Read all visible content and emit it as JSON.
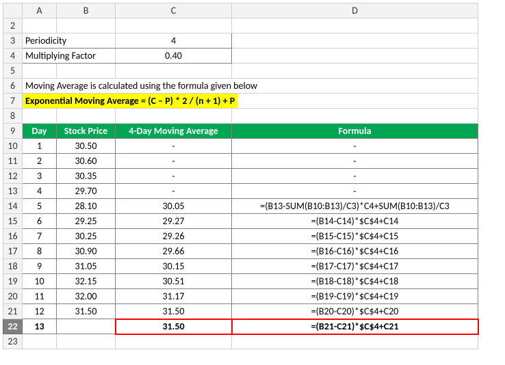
{
  "columns": [
    "A",
    "B",
    "C",
    "D"
  ],
  "params": {
    "periodicity_label": "Periodicity",
    "periodicity_value": "4",
    "factor_label": "Multiplying Factor",
    "factor_value": "0.40"
  },
  "note": "Moving Average is calculated using the formula given below",
  "formula_text": "Exponential Moving Average = (C – P) * 2 / (n + 1) + P",
  "headers": {
    "day": "Day",
    "price": "Stock Price",
    "mavg": "4-Day Moving Average",
    "formula": "Formula"
  },
  "rows": [
    {
      "r": "10",
      "day": "1",
      "price": "30.50",
      "mavg": "-",
      "formula": "-"
    },
    {
      "r": "11",
      "day": "2",
      "price": "30.60",
      "mavg": "-",
      "formula": "-"
    },
    {
      "r": "12",
      "day": "3",
      "price": "30.35",
      "mavg": "-",
      "formula": "-"
    },
    {
      "r": "13",
      "day": "4",
      "price": "29.70",
      "mavg": "-",
      "formula": "-"
    },
    {
      "r": "14",
      "day": "5",
      "price": "28.10",
      "mavg": "30.05",
      "formula": "=(B13-SUM(B10:B13)/C3)*C4+SUM(B10:B13)/C3"
    },
    {
      "r": "15",
      "day": "6",
      "price": "29.25",
      "mavg": "29.27",
      "formula": "=(B14-C14)*$C$4+C14"
    },
    {
      "r": "16",
      "day": "7",
      "price": "30.25",
      "mavg": "29.26",
      "formula": "=(B15-C15)*$C$4+C15"
    },
    {
      "r": "17",
      "day": "8",
      "price": "30.90",
      "mavg": "29.66",
      "formula": "=(B16-C16)*$C$4+C16"
    },
    {
      "r": "18",
      "day": "9",
      "price": "31.05",
      "mavg": "30.15",
      "formula": "=(B17-C17)*$C$4+C17"
    },
    {
      "r": "19",
      "day": "10",
      "price": "32.15",
      "mavg": "30.51",
      "formula": "=(B18-C18)*$C$4+C18"
    },
    {
      "r": "20",
      "day": "11",
      "price": "32.00",
      "mavg": "31.17",
      "formula": "=(B19-C19)*$C$4+C19"
    },
    {
      "r": "21",
      "day": "12",
      "price": "31.50",
      "mavg": "31.50",
      "formula": "=(B20-C20)*$C$4+C20"
    }
  ],
  "result_row": {
    "r": "22",
    "day": "13",
    "price": "",
    "mavg": "31.50",
    "formula": "=(B21-C21)*$C$4+C21"
  },
  "row_labels": {
    "r2": "2",
    "r3": "3",
    "r4": "4",
    "r5": "5",
    "r6": "6",
    "r7": "7",
    "r8": "8",
    "r9": "9",
    "r23": "23"
  },
  "chart_data": {
    "type": "table",
    "title": "4-Day Exponential Moving Average",
    "parameters": {
      "periodicity": 4,
      "multiplying_factor": 0.4
    },
    "columns": [
      "Day",
      "Stock Price",
      "4-Day Moving Average",
      "Formula"
    ],
    "data": [
      [
        1,
        30.5,
        null,
        null
      ],
      [
        2,
        30.6,
        null,
        null
      ],
      [
        3,
        30.35,
        null,
        null
      ],
      [
        4,
        29.7,
        null,
        null
      ],
      [
        5,
        28.1,
        30.05,
        "=(B13-SUM(B10:B13)/C3)*C4+SUM(B10:B13)/C3"
      ],
      [
        6,
        29.25,
        29.27,
        "=(B14-C14)*$C$4+C14"
      ],
      [
        7,
        30.25,
        29.26,
        "=(B15-C15)*$C$4+C15"
      ],
      [
        8,
        30.9,
        29.66,
        "=(B16-C16)*$C$4+C16"
      ],
      [
        9,
        31.05,
        30.15,
        "=(B17-C17)*$C$4+C17"
      ],
      [
        10,
        32.15,
        30.51,
        "=(B18-C18)*$C$4+C18"
      ],
      [
        11,
        32.0,
        31.17,
        "=(B19-C19)*$C$4+C19"
      ],
      [
        12,
        31.5,
        31.5,
        "=(B20-C20)*$C$4+C20"
      ],
      [
        13,
        null,
        31.5,
        "=(B21-C21)*$C$4+C21"
      ]
    ]
  }
}
